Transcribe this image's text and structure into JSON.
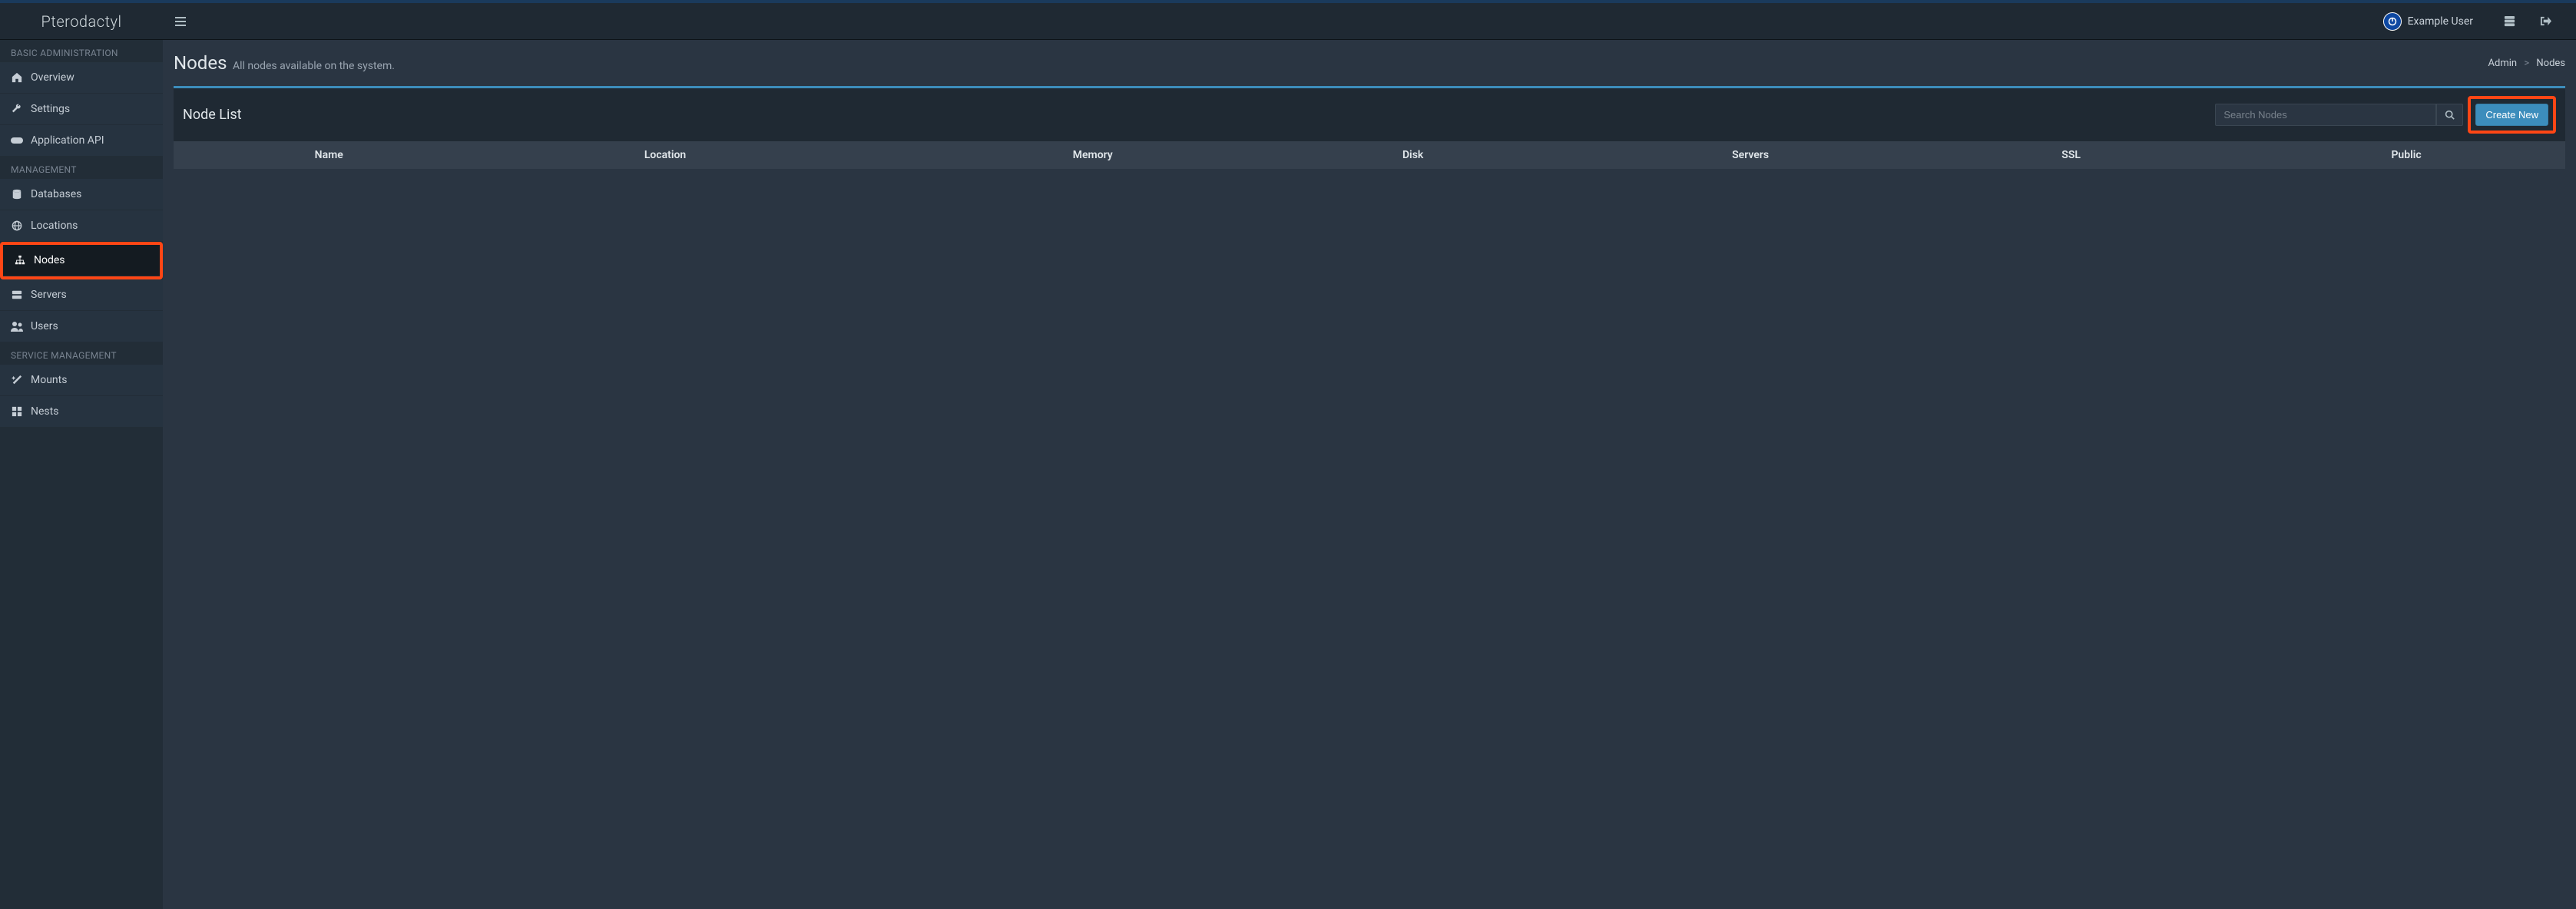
{
  "brand": "Pterodactyl",
  "user": {
    "name": "Example User"
  },
  "sidebar": {
    "sections": [
      {
        "label": "BASIC ADMINISTRATION",
        "items": [
          {
            "label": "Overview",
            "icon": "home"
          },
          {
            "label": "Settings",
            "icon": "wrench"
          },
          {
            "label": "Application API",
            "icon": "gamepad"
          }
        ]
      },
      {
        "label": "MANAGEMENT",
        "items": [
          {
            "label": "Databases",
            "icon": "database"
          },
          {
            "label": "Locations",
            "icon": "globe"
          },
          {
            "label": "Nodes",
            "icon": "sitemap"
          },
          {
            "label": "Servers",
            "icon": "server"
          },
          {
            "label": "Users",
            "icon": "users"
          }
        ]
      },
      {
        "label": "SERVICE MANAGEMENT",
        "items": [
          {
            "label": "Mounts",
            "icon": "magic"
          },
          {
            "label": "Nests",
            "icon": "th-large"
          }
        ]
      }
    ]
  },
  "page": {
    "title": "Nodes",
    "subtitle": "All nodes available on the system.",
    "breadcrumb": {
      "root": "Admin",
      "current": "Nodes"
    }
  },
  "box": {
    "title": "Node List",
    "search_placeholder": "Search Nodes",
    "create_label": "Create New"
  },
  "table": {
    "columns": [
      "",
      "Name",
      "Location",
      "Memory",
      "Disk",
      "Servers",
      "SSL",
      "Public"
    ],
    "rows": []
  }
}
